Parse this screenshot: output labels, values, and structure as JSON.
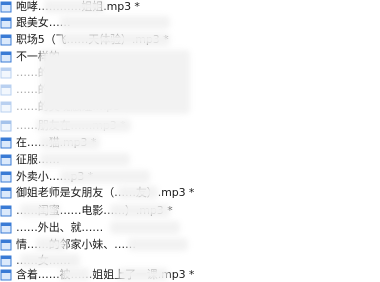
{
  "file_list": {
    "items": [
      {
        "label": "咆哮…………姐姐.mp3 *",
        "style": "normal"
      },
      {
        "label": "跟美女……",
        "style": "normal"
      },
      {
        "label": "职场5（飞……天体验）.mp3 *",
        "style": "normal"
      },
      {
        "label": "不一样的……",
        "style": "normal"
      },
      {
        "label": "……的女同桌的……",
        "style": "light"
      },
      {
        "label": "……的……",
        "style": "light"
      },
      {
        "label": "……的灵魂触碰.mp3 *",
        "style": "light"
      },
      {
        "label": "……朋友在……mp3 *",
        "style": "light"
      },
      {
        "label": "在……猫.mp3 *",
        "style": "normal"
      },
      {
        "label": "征服……",
        "style": "normal"
      },
      {
        "label": "外卖小……p3 *",
        "style": "normal"
      },
      {
        "label": "御姐老师是女朋友（……友）.mp3 *",
        "style": "normal"
      },
      {
        "label": "……闺蜜……电影……）.mp3 *",
        "style": "normal"
      },
      {
        "label": "……外出、就……",
        "style": "normal"
      },
      {
        "label": "情……的邻家小妹、……",
        "style": "normal"
      },
      {
        "label": "……女……",
        "style": "normal"
      },
      {
        "label": "含着……被……姐姐上了一课.mp3 *",
        "style": "normal"
      }
    ]
  },
  "icon": {
    "name": "audio-file-icon",
    "color": "#3a7bd5"
  }
}
